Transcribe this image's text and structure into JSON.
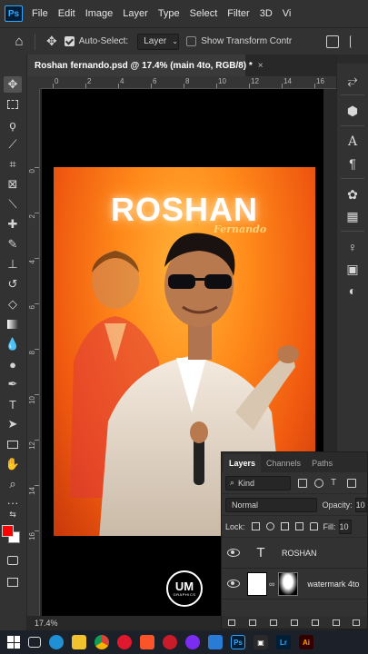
{
  "app": {
    "logo": "Ps",
    "menu": [
      "File",
      "Edit",
      "Image",
      "Layer",
      "Type",
      "Select",
      "Filter",
      "3D",
      "Vi"
    ]
  },
  "options": {
    "auto_select_label": "Auto-Select:",
    "auto_select_target": "Layer",
    "show_transform_label": "Show Transform Contr"
  },
  "document": {
    "tab_title": "Roshan fernando.psd @ 17.4% (main 4to, RGB/8) *",
    "close_glyph": "×",
    "zoom_status": "17.4%"
  },
  "ruler": {
    "h_labels": [
      "0",
      "2",
      "4",
      "6",
      "8",
      "10",
      "12",
      "14",
      "16"
    ],
    "v_labels": [
      "0",
      "2",
      "4",
      "6",
      "8",
      "10",
      "12",
      "14",
      "16"
    ]
  },
  "artwork": {
    "title": "ROSHAN",
    "subtitle": "Fernando",
    "watermark": "UM",
    "watermark_sub": "GRAPHICS"
  },
  "layers_panel": {
    "tabs": [
      "Layers",
      "Channels",
      "Paths"
    ],
    "kind_filter": "Kind",
    "blend_mode": "Normal",
    "opacity_label": "Opacity:",
    "opacity_value": "10",
    "lock_label": "Lock:",
    "fill_label": "Fill:",
    "fill_value": "10",
    "layers": [
      {
        "name": "ROSHAN",
        "type": "text",
        "visible": true
      },
      {
        "name": "watermark 4to",
        "type": "smart",
        "visible": true
      }
    ]
  },
  "colors": {
    "foreground": "#ff0000",
    "background": "#ffffff",
    "ui_panel": "#323232"
  }
}
